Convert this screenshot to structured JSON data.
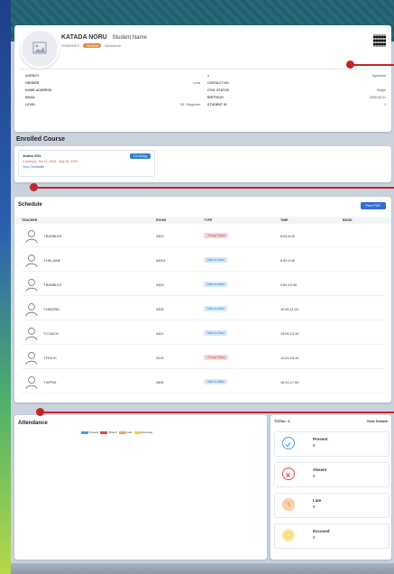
{
  "profile": {
    "last_name": "KATADA NORU",
    "name_label": "Student Name",
    "sub_name": "NOBUMEX",
    "badge": "Student",
    "nickname_label": "Nickname",
    "info": [
      {
        "l1": "AGENCY",
        "v1": "",
        "l2": "",
        "v2": "1",
        "v3": "Japanese"
      },
      {
        "l1": "GENDER",
        "v1": "Lexa",
        "l2": "CONTACT NO.",
        "v2": "",
        "v3": ""
      },
      {
        "l1": "HOME ADDRESS",
        "v1": "",
        "l2": "CIVIL STATUS",
        "v2": "",
        "v3": "Single"
      },
      {
        "l1": "EMAIL",
        "v1": "",
        "l2": "BIRTHDAY",
        "v2": "",
        "v3": "2005-03-11"
      },
      {
        "l1": "LEVEL",
        "v1": "B1 / Beginner",
        "l2": "STUDENT ID",
        "v2": "",
        "v3": "1"
      }
    ]
  },
  "course": {
    "title": "Enrolled Course",
    "name": "Junior ESL",
    "schedule": "4 week(s): Jun 14, 2024 - Aug 16, 2024",
    "link": "View Certificate",
    "status": "On Going"
  },
  "schedule": {
    "title": "Schedule",
    "print_label": "Print PDF",
    "headers": {
      "teacher": "TEACHER",
      "room": "ROOM",
      "type": "TYPE",
      "time": "TIME",
      "book": "BOOK"
    },
    "rows": [
      {
        "teacher": "T.BUBBLES",
        "room": "3303",
        "type": "Group Class",
        "time": "8:00-8:40",
        "color": "#f6d5d2",
        "text": "#d0443a"
      },
      {
        "teacher": "T.HELAINE",
        "room": "#3301",
        "type": "Man to Man",
        "time": "8:50-9:40",
        "color": "#d6e8fa",
        "text": "#2f7fd6"
      },
      {
        "teacher": "T.BUBBLES",
        "room": "3303",
        "type": "Man to Man",
        "time": "9:50-10:30",
        "color": "#d6e8fa",
        "text": "#2f7fd6"
      },
      {
        "teacher": "T.NIDORA",
        "room": "3308",
        "type": "Man to Man",
        "time": "10:40-11:20",
        "color": "#d6e8fa",
        "text": "#2f7fd6"
      },
      {
        "teacher": "T.COACH",
        "room": "4401",
        "type": "Man to Man",
        "time": "13:00-13:10",
        "color": "#d6e8fa",
        "text": "#2f7fd6"
      },
      {
        "teacher": "T.FINCH",
        "room": "3315",
        "type": "Group Class",
        "time": "14:20-15:10",
        "color": "#f6d5d2",
        "text": "#d0443a"
      },
      {
        "teacher": "T.APRIA",
        "room": "4506",
        "type": "Man to Man",
        "time": "16:10-17:00",
        "color": "#d6e8fa",
        "text": "#2f7fd6"
      }
    ]
  },
  "attendance": {
    "title": "Attendance",
    "legend": [
      {
        "label": "Present",
        "color": "#4b9fe0"
      },
      {
        "label": "Absent",
        "color": "#e04b4b"
      },
      {
        "label": "Late",
        "color": "#f0a45a"
      },
      {
        "label": "Excused",
        "color": "#f6cf4a"
      }
    ],
    "total_label": "TOTAL: 0",
    "view_details": "View Details",
    "stats": [
      {
        "label": "Present",
        "value": "0",
        "color": "#4b9fe0",
        "icon": "check-icon"
      },
      {
        "label": "Absent",
        "value": "0",
        "color": "#e04b4b",
        "icon": "x-icon"
      },
      {
        "label": "Late",
        "value": "0",
        "color": "#f0a45a",
        "icon": "clock-icon"
      },
      {
        "label": "Excused",
        "value": "0",
        "color": "#f6cf4a",
        "icon": "info-icon"
      }
    ]
  }
}
